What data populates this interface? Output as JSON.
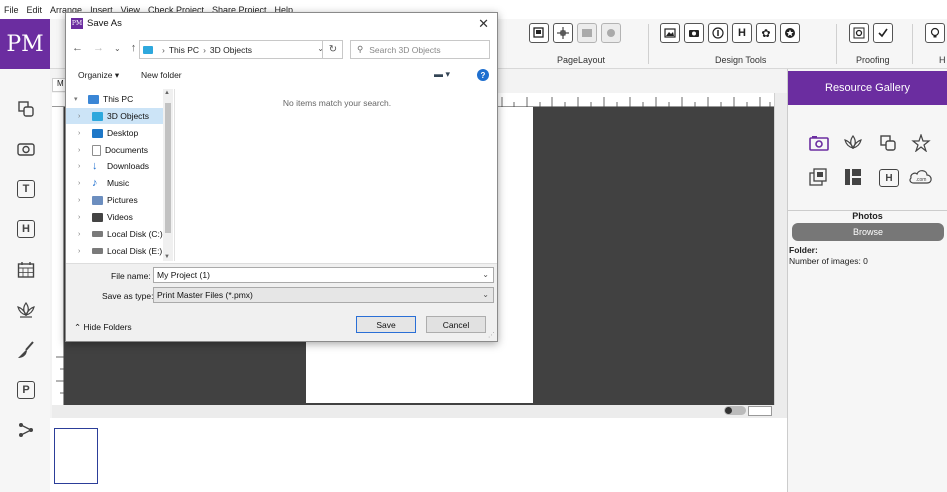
{
  "menu": [
    "File",
    "Edit",
    "Arrange",
    "Insert",
    "View",
    "Check Project",
    "Share Project",
    "Help"
  ],
  "app": {
    "logo": "PM",
    "accent": "#6b2da0"
  },
  "ribbon": {
    "pagelayout_label": "PageLayout",
    "designtools_label": "Design Tools",
    "proofing_label": "Proofing",
    "help_label": "H",
    "designtools_h": "H"
  },
  "left_tools": {
    "text_tool": "T",
    "headline_tool": "H",
    "publisher_tool": "P"
  },
  "workspace": {
    "tab_label": "M"
  },
  "gallery": {
    "title": "Resource Gallery",
    "headline_icon": "H",
    "web_icon": ".com",
    "section_title": "Photos",
    "browse_label": "Browse",
    "folder_label": "Folder:",
    "count_label": "Number of images: 0"
  },
  "dialog": {
    "title": "Save As",
    "app_icon": "PM",
    "path": [
      "This PC",
      "3D Objects"
    ],
    "search_placeholder": "Search 3D Objects",
    "organize_label": "Organize ▾",
    "new_folder_label": "New folder",
    "tree": [
      {
        "label": "This PC",
        "icon": "pc-icon",
        "color": "#3a86d6"
      },
      {
        "label": "3D Objects",
        "icon": "3d-objects-icon",
        "color": "#2ea8dd",
        "selected": true
      },
      {
        "label": "Desktop",
        "icon": "desktop-icon",
        "color": "#1e78c8"
      },
      {
        "label": "Documents",
        "icon": "documents-icon",
        "color": "#8e8e8e"
      },
      {
        "label": "Downloads",
        "icon": "downloads-icon",
        "color": "#1f6fcf"
      },
      {
        "label": "Music",
        "icon": "music-icon",
        "color": "#1f6fcf"
      },
      {
        "label": "Pictures",
        "icon": "pictures-icon",
        "color": "#6c8ebf"
      },
      {
        "label": "Videos",
        "icon": "videos-icon",
        "color": "#444444"
      },
      {
        "label": "Local Disk (C:)",
        "icon": "disk-icon",
        "color": "#7a7a7a"
      },
      {
        "label": "Local Disk (E:)",
        "icon": "disk-icon",
        "color": "#7a7a7a"
      }
    ],
    "empty_message": "No items match your search.",
    "file_name_label": "File name:",
    "file_name_value": "My Project (1)",
    "save_type_label": "Save as type:",
    "save_type_value": "Print Master Files (*.pmx)",
    "hide_folders_label": "Hide Folders",
    "save_label": "Save",
    "cancel_label": "Cancel"
  }
}
